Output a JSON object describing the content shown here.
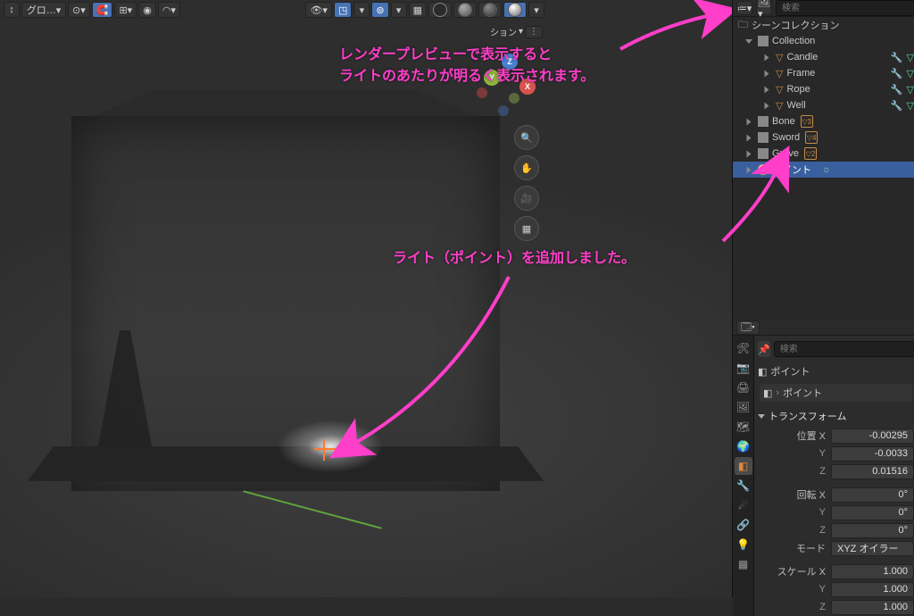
{
  "header": {
    "mode_icon": "↕",
    "global_label": "グロ…",
    "dropdown_sep": "▾"
  },
  "viewport_right": {
    "shading": [
      "wireframe",
      "solid",
      "material",
      "rendered"
    ]
  },
  "gizmo": {
    "x": "X",
    "y": "Y",
    "z": "Z"
  },
  "annotations": {
    "a1_line1": "レンダープレビューで表示すると",
    "a1_line2": "ライトのあたりが明るく表示されます。",
    "a2": "ライト（ポイント）を追加しました。"
  },
  "outliner": {
    "search_placeholder": "検索",
    "root": "シーンコレクション",
    "collection": "Collection",
    "items": [
      {
        "name": "Candle"
      },
      {
        "name": "Frame"
      },
      {
        "name": "Rope"
      },
      {
        "name": "Well"
      }
    ],
    "bone": {
      "name": "Bone",
      "count": "3"
    },
    "sword": {
      "name": "Sword",
      "count": "4"
    },
    "grave": {
      "name": "Grave",
      "count": "2"
    },
    "point": {
      "name": "ポイント"
    }
  },
  "props": {
    "search_placeholder": "検索",
    "crumb_obj": "ポイント",
    "crumb_data": "ポイント",
    "panel_transform": "トランスフォーム",
    "fields": {
      "loc_label": "位置 X",
      "loc_x": "-0.00295",
      "loc_y_label": "Y",
      "loc_y": "-0.0033",
      "loc_z_label": "Z",
      "loc_z": "0.01516",
      "rot_label": "回転 X",
      "rot_x": "0°",
      "rot_y_label": "Y",
      "rot_y": "0°",
      "rot_z_label": "Z",
      "rot_z": "0°",
      "mode_label": "モード",
      "mode_val": "XYZ オイラー",
      "scale_label": "スケール X",
      "scale_x": "1.000",
      "scale_y_label": "Y",
      "scale_y": "1.000",
      "scale_z_label": "Z",
      "scale_z": "1.000"
    }
  }
}
